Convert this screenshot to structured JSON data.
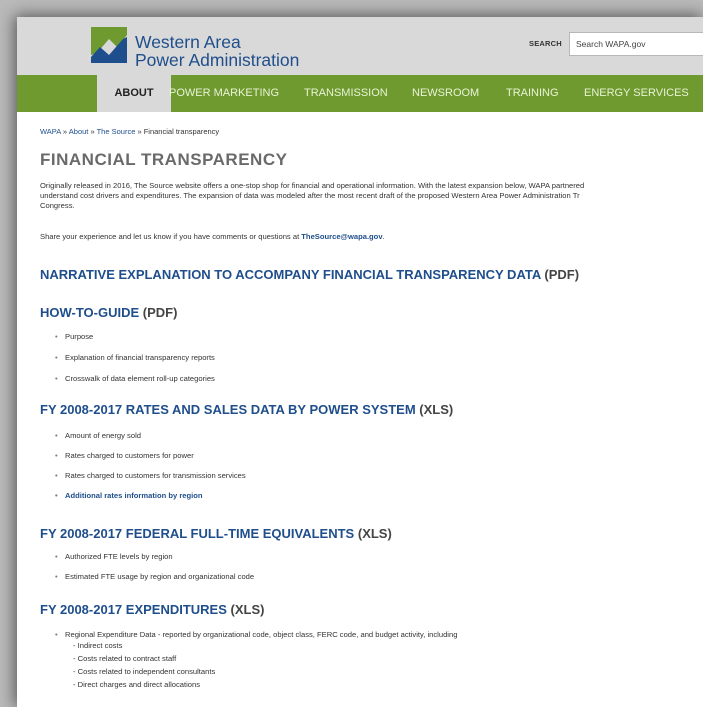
{
  "brand": {
    "line1": "Western Area",
    "line2": "Power Administration",
    "color_blue": "#1f4e8c",
    "color_green": "#6f9a2f",
    "logo_icon": "wapa-lightning-logo-icon"
  },
  "search": {
    "label": "SEARCH",
    "placeholder": "Search WAPA.gov"
  },
  "nav": {
    "items": [
      {
        "label": "ABOUT",
        "active": true
      },
      {
        "label": "POWER MARKETING"
      },
      {
        "label": "TRANSMISSION"
      },
      {
        "label": "NEWSROOM"
      },
      {
        "label": "TRAINING"
      },
      {
        "label": "ENERGY SERVICES"
      }
    ]
  },
  "breadcrumb": {
    "items": [
      "WAPA",
      "About",
      "The Source"
    ],
    "separator": " » ",
    "current": "Financial transparency"
  },
  "page": {
    "title": "FINANCIAL TRANSPARENCY",
    "intro_lines": [
      "Originally released in 2016, The Source website offers a one-stop shop for financial and operational information. With the latest expansion below, WAPA partnered",
      "understand cost drivers and expenditures. The expansion of data was modeled after the most recent draft of the proposed Western Area Power Administration Tr",
      "Congress."
    ],
    "share_text": "Share your experience and let us know if you have comments or questions at ",
    "share_email": "TheSource@wapa.gov",
    "share_end": "."
  },
  "sections": [
    {
      "title": "NARRATIVE EXPLANATION TO ACCOMPANY FINANCIAL TRANSPARENCY DATA",
      "suffix": "(PDF)",
      "items": []
    },
    {
      "title": "HOW-TO-GUIDE",
      "suffix": "(PDF)",
      "items": [
        "Purpose",
        "Explanation of financial transparency reports",
        "Crosswalk of data element roll-up categories"
      ]
    },
    {
      "title": "FY 2008-2017 RATES AND SALES DATA BY POWER SYSTEM",
      "suffix": "(XLS)",
      "items": [
        "Amount of energy sold",
        "Rates charged to customers for power",
        "Rates charged to customers for transmission services"
      ],
      "link_item": "Additional rates information by region"
    },
    {
      "title": "FY 2008-2017 FEDERAL FULL-TIME EQUIVALENTS",
      "suffix": "(XLS)",
      "items": [
        "Authorized FTE levels by region",
        "Estimated FTE usage by region and organizational code"
      ]
    },
    {
      "title": "FY 2008-2017 EXPENDITURES",
      "suffix": "(XLS)",
      "items": [
        "Regional Expenditure Data - reported by organizational code, object class, FERC code, and budget activity, including"
      ],
      "subitems": [
        "- Indirect costs",
        "- Costs related to contract staff",
        "- Costs related to independent consultants",
        "- Direct charges and direct allocations"
      ]
    }
  ]
}
